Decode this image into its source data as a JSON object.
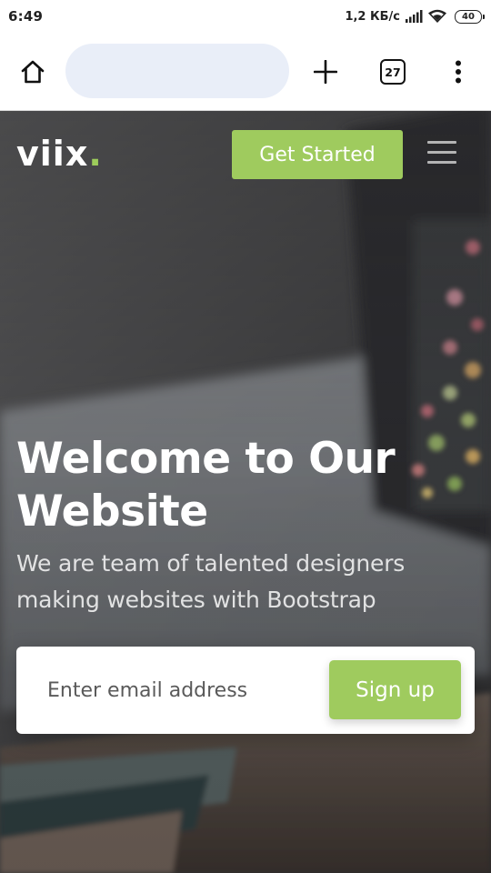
{
  "status_bar": {
    "time": "6:49",
    "network_speed": "1,2 КБ/с",
    "battery": "40",
    "icons": [
      "signal-icon",
      "wifi-icon",
      "battery-icon"
    ]
  },
  "browser": {
    "url_value": "",
    "tab_count": "27",
    "icons": [
      "home-icon",
      "plus-icon",
      "tabs-icon",
      "more-vert-icon"
    ]
  },
  "site": {
    "logo_text": "viix",
    "logo_dot": ".",
    "cta_label": "Get Started",
    "hero_title": "Welcome to Our Website",
    "hero_subtitle": "We are team of talented designers making websites with Bootstrap",
    "email_placeholder": "Enter email address",
    "signup_label": "Sign up"
  },
  "colors": {
    "accent": "#9fcb5e",
    "text_light": "#ffffff",
    "url_bar_bg": "#e9eef8"
  }
}
